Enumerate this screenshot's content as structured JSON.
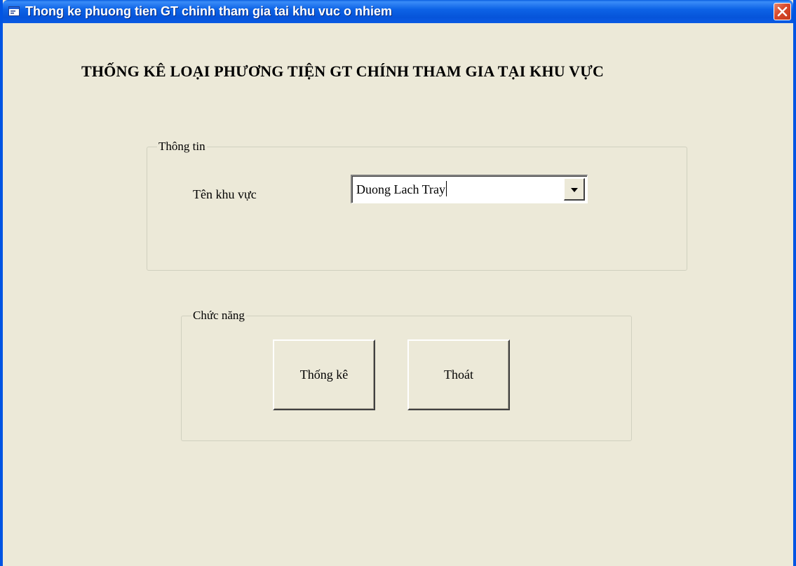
{
  "window": {
    "title": "Thong ke phuong tien GT chinh tham gia tai khu vuc o nhiem",
    "icon": "app-window-icon",
    "close_icon": "close-icon"
  },
  "form": {
    "heading": "THỐNG KÊ LOẠI PHƯƠNG TIỆN GT CHÍNH THAM GIA TẠI KHU VỰC",
    "info_group": {
      "legend": "Thông tin",
      "area_label": "Tên khu vực",
      "area_value": "Duong Lach Tray"
    },
    "func_group": {
      "legend": "Chức năng",
      "stats_button": "Thống kê",
      "exit_button": "Thoát"
    }
  },
  "colors": {
    "titlebar": "#0054E3",
    "face": "#ECE9D8",
    "close": "#D8482A"
  }
}
